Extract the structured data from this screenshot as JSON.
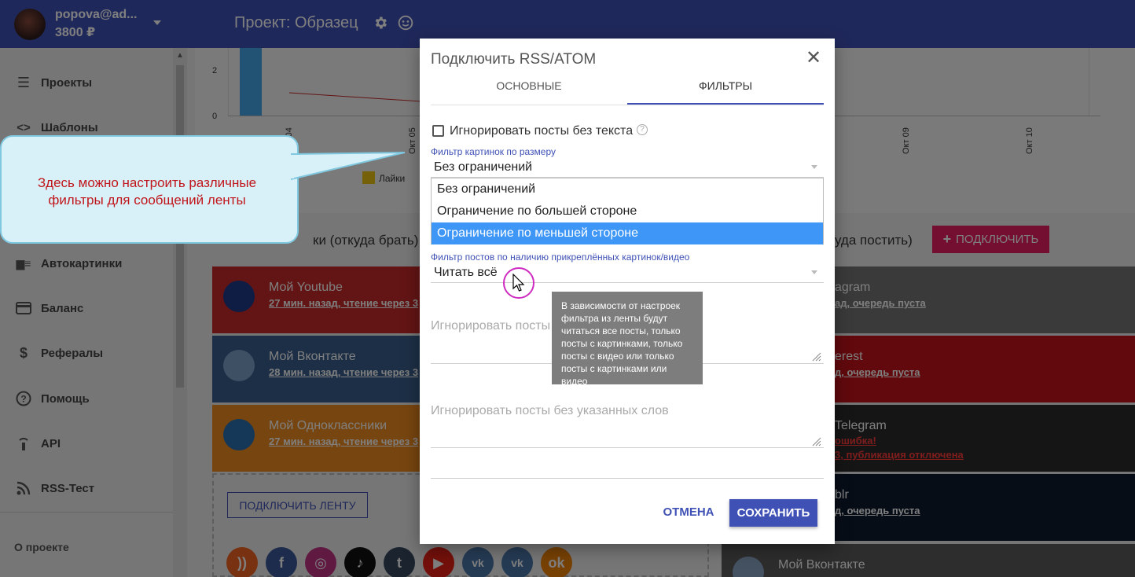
{
  "header": {
    "user_name": "popova@ad...",
    "balance": "3800 ₽",
    "project_title": "Проект: Образец"
  },
  "sidebar": {
    "items": [
      {
        "label": "Проекты",
        "icon": "list-icon"
      },
      {
        "label": "Шаблоны",
        "icon": "code-icon"
      },
      {
        "label": "Автокартинки",
        "icon": "image-list-icon"
      },
      {
        "label": "Баланс",
        "icon": "card-icon"
      },
      {
        "label": "Рефералы",
        "icon": "dollar-icon"
      },
      {
        "label": "Помощь",
        "icon": "help-icon"
      },
      {
        "label": "API",
        "icon": "api-icon"
      },
      {
        "label": "RSS-Тест",
        "icon": "rss-icon"
      }
    ],
    "footer": "О проекте"
  },
  "chart": {
    "y_labels": [
      "2",
      "0"
    ],
    "x_ticks": [
      "Окт 04",
      "Окт 05",
      "Окт 09",
      "Окт 10"
    ],
    "legend": "Лайки"
  },
  "sections": {
    "left_title": "ки (откуда брать)",
    "right_title": "уда постить)",
    "connect_button": "ПОДКЛЮЧИТЬ",
    "connect_feed_button": "ПОДКЛЮЧИТЬ ЛЕНТУ"
  },
  "left_cards": [
    {
      "name": "Мой Youtube",
      "sub": "27 мин. назад, чтение через 3",
      "color": "#c62828"
    },
    {
      "name": "Мой Вконтакте",
      "sub": "28 мин. назад, чтение через 3",
      "color": "#3b5e8c"
    },
    {
      "name": "Мой Одноклассники",
      "sub": "27 мин. назад, чтение через 3",
      "color": "#ef8a1e"
    }
  ],
  "right_cards": [
    {
      "name": "agram",
      "sub": "ад, очередь пуста",
      "color": "#757575"
    },
    {
      "name": "erest",
      "sub": "д, очередь пуста",
      "color": "#c2131b"
    },
    {
      "name": "Telegram",
      "sub": "ошибка!",
      "sub2": "3, публикация отключена",
      "color": "#2b2b2b"
    },
    {
      "name": "blr",
      "sub": "д, очередь пуста",
      "color": "#0f1b2f"
    },
    {
      "name": "Мой Вконтакте",
      "sub": "",
      "color": "#5b5b5b"
    }
  ],
  "callout": {
    "text": "Здесь можно настроить различные фильтры для сообщений ленты"
  },
  "modal": {
    "title": "Подключить RSS/ATOM",
    "tabs": [
      "ОСНОВНЫЕ",
      "ФИЛЬТРЫ"
    ],
    "active_tab": "ФИЛЬТРЫ",
    "checkbox_label": "Игнорировать посты без текста",
    "image_filter_label": "Фильтр картинок по размеру",
    "image_filter_value": "Без ограничений",
    "image_filter_options": [
      "Без ограничений",
      "Ограничение по большей стороне",
      "Ограничение по меньшей стороне"
    ],
    "image_filter_highlighted": "Ограничение по меньшей стороне",
    "attach_filter_label": "Фильтр постов по наличию прикреплённых картинок/видео",
    "attach_filter_value": "Читать всё",
    "ignore_with_words_placeholder": "Игнорировать посты с",
    "ignore_without_words_placeholder": "Игнорировать посты без указанных слов",
    "cancel": "ОТМЕНА",
    "save": "СОХРАНИТЬ"
  },
  "tooltip": {
    "text": "В зависимости от настроек фильтра из ленты будут читаться все посты, только посты с картинками, только посты с видео или только посты с картинками или видео"
  },
  "colors": {
    "primary": "#3f51b5",
    "accent": "#e91e63",
    "dropdown_highlight": "#3e97f7",
    "callout_text": "#c0161b"
  }
}
